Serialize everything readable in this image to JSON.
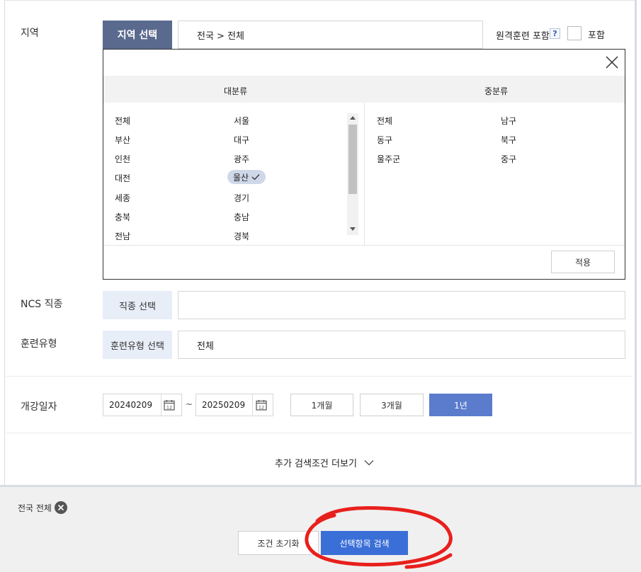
{
  "region": {
    "label": "지역",
    "select_button": "지역 선택",
    "selected_path": "전국 > 전체",
    "remote_label": "원격훈련 포함",
    "help": "?",
    "include_label": "포함"
  },
  "region_panel": {
    "major_header": "대분류",
    "minor_header": "중분류",
    "major_left": [
      "전체",
      "부산",
      "인천",
      "대전",
      "세종",
      "충북",
      "전남"
    ],
    "major_right": [
      "서울",
      "대구",
      "광주",
      "울산",
      "경기",
      "충남",
      "경북"
    ],
    "minor_left": [
      "전체",
      "동구",
      "울주군"
    ],
    "minor_right": [
      "남구",
      "북구",
      "중구"
    ],
    "apply_button": "적용"
  },
  "ncs": {
    "label": "NCS 직종",
    "select_button": "직종 선택",
    "value": ""
  },
  "training_type": {
    "label": "훈련유형",
    "select_button": "훈련유형 선택",
    "value": "전체"
  },
  "start_date": {
    "label": "개강일자",
    "from": "20240209",
    "separator": "~",
    "to": "20250209",
    "periods": [
      "1개월",
      "3개월",
      "1년"
    ]
  },
  "more_conditions": "추가 검색조건 더보기",
  "summary": {
    "chip": "전국 전체"
  },
  "actions": {
    "reset": "조건 초기화",
    "search": "선택항목 검색"
  },
  "colors": {
    "dark_button": "#5a6a8e",
    "light_button": "#e8eef8",
    "active_period": "#5b7ccd",
    "search_button": "#3b6fd8",
    "annotation": "#e8201c"
  }
}
